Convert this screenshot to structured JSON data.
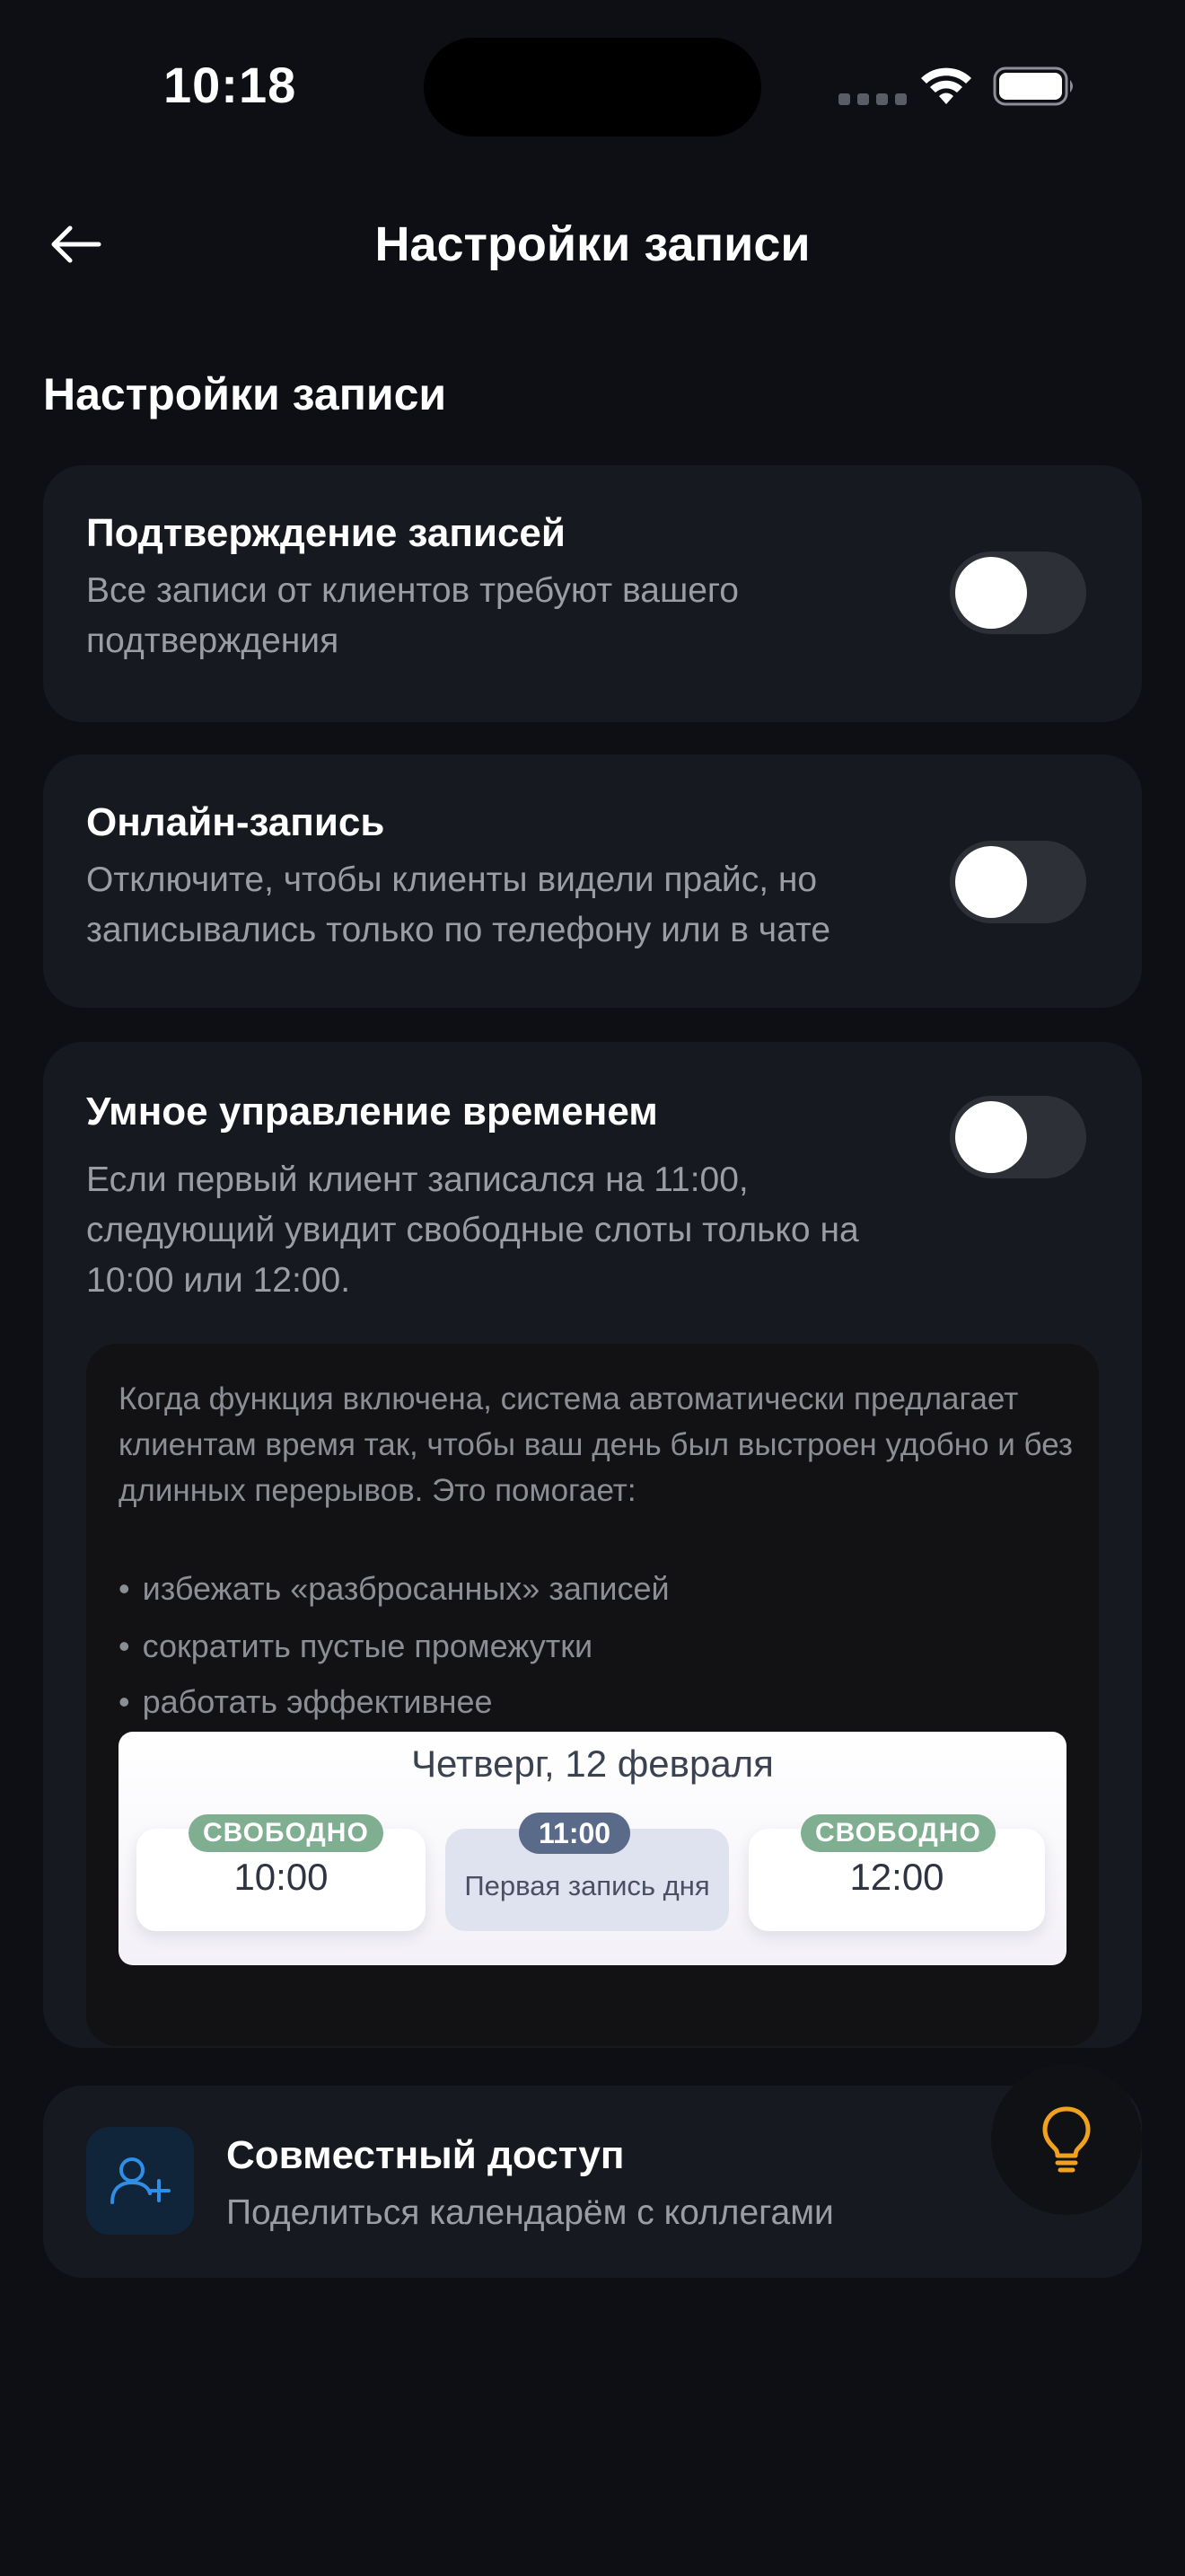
{
  "status_bar": {
    "time": "10:18",
    "icons": [
      "signal-dots-icon",
      "wifi-icon",
      "battery-icon"
    ]
  },
  "header": {
    "back_icon": "arrow-left-icon",
    "title": "Настройки записи"
  },
  "section": {
    "title": "Настройки записи"
  },
  "settings": [
    {
      "title": "Подтверждение записей",
      "description": "Все записи от клиентов требуют вашего подтверждения",
      "enabled": false
    },
    {
      "title": "Онлайн-запись",
      "description": "Отключите, чтобы клиенты видели прайс, но записывались только по телефону или в чате",
      "enabled": false
    },
    {
      "title": "Умное управление временем",
      "description": "Если первый клиент записался на 11:00, следующий увидит свободные слоты только на 10:00 или 12:00.",
      "enabled": false
    }
  ],
  "info": {
    "text": "Когда функция включена, система автоматически предлагает клиентам время так, чтобы ваш день был выстроен удобно и без длинных перерывов. Это помогает:",
    "bullets": [
      "избежать «разбросанных» записей",
      "сократить пустые промежутки",
      "работать эффективнее"
    ],
    "preview": {
      "date": "Четверг, 12 февраля",
      "slot_left_badge": "СВОБОДНО",
      "slot_left_time": "10:00",
      "slot_mid_badge": "11:00",
      "slot_mid_label": "Первая запись дня",
      "slot_right_badge": "СВОБОДНО",
      "slot_right_time": "12:00"
    }
  },
  "shared_access": {
    "icon": "add-user-icon",
    "title": "Совместный доступ",
    "description": "Поделиться календарём с коллегами"
  },
  "fab": {
    "icon": "lightbulb-icon"
  },
  "colors": {
    "background": "#0d0f14",
    "card": "#171920",
    "accent_blue": "#2f8ee6",
    "accent_orange": "#f0a21e",
    "badge_green": "#7fae90"
  }
}
